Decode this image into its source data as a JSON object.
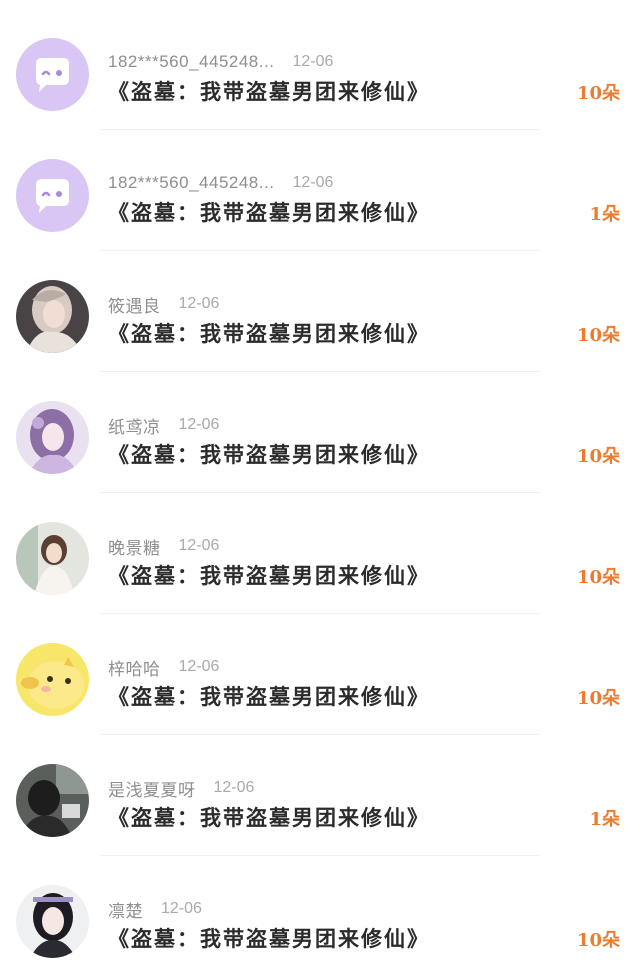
{
  "comments": [
    {
      "user": "182***560_445248...",
      "date": "12-06",
      "book": "《盗墓：我带盗墓男团来修仙》",
      "gift": "10朵",
      "avatar": "chat-bubble-icon"
    },
    {
      "user": "182***560_445248...",
      "date": "12-06",
      "book": "《盗墓：我带盗墓男团来修仙》",
      "gift": "1朵",
      "avatar": "chat-bubble-icon"
    },
    {
      "user": "筱遇良",
      "date": "12-06",
      "book": "《盗墓：我带盗墓男团来修仙》",
      "gift": "10朵",
      "avatar": "portrait-photo"
    },
    {
      "user": "纸鸢凉",
      "date": "12-06",
      "book": "《盗墓：我带盗墓男团来修仙》",
      "gift": "10朵",
      "avatar": "portrait-photo"
    },
    {
      "user": "晚景糖",
      "date": "12-06",
      "book": "《盗墓：我带盗墓男团来修仙》",
      "gift": "10朵",
      "avatar": "portrait-photo"
    },
    {
      "user": "梓哈哈",
      "date": "12-06",
      "book": "《盗墓：我带盗墓男团来修仙》",
      "gift": "10朵",
      "avatar": "yellow-chick-icon"
    },
    {
      "user": "是浅夏夏呀",
      "date": "12-06",
      "book": "《盗墓：我带盗墓男团来修仙》",
      "gift": "1朵",
      "avatar": "portrait-photo"
    },
    {
      "user": "凛楚",
      "date": "12-06",
      "book": "《盗墓：我带盗墓男团来修仙》",
      "gift": "10朵",
      "avatar": "portrait-photo"
    }
  ],
  "colors": {
    "accent": "#ef7b2e",
    "default_avatar": "#d9c6f5"
  }
}
